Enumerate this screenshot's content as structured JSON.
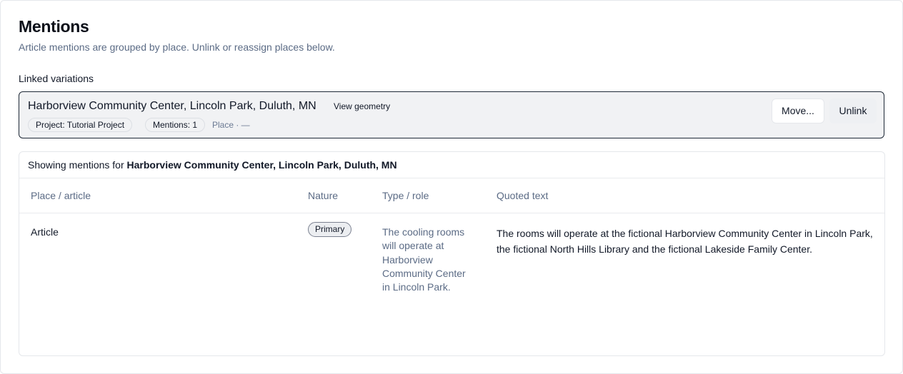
{
  "header": {
    "title": "Mentions",
    "subtitle": "Article mentions are grouped by place. Unlink or reassign places below."
  },
  "linked": {
    "section_label": "Linked variations",
    "variation": {
      "name": "Harborview Community Center, Lincoln Park, Duluth, MN",
      "view_geometry_label": "View geometry",
      "project_chip": "Project: Tutorial Project",
      "mentions_chip": "Mentions: 1",
      "place_meta": "Place · —",
      "move_label": "Move...",
      "unlink_label": "Unlink"
    }
  },
  "mentions_panel": {
    "showing_prefix": "Showing mentions for",
    "showing_place": "Harborview Community Center, Lincoln Park, Duluth, MN",
    "columns": [
      "Place / article",
      "Nature",
      "Type / role",
      "Quoted text"
    ],
    "rows": [
      {
        "place": "Article",
        "nature": "Primary",
        "role": "The cooling rooms will operate at Harborview Community Center in Lincoln Park.",
        "quote": "The rooms will operate at the fictional Harborview Community Center in Lincoln Park, the fictional North Hills Library and the fictional Lakeside Family Center."
      }
    ]
  }
}
